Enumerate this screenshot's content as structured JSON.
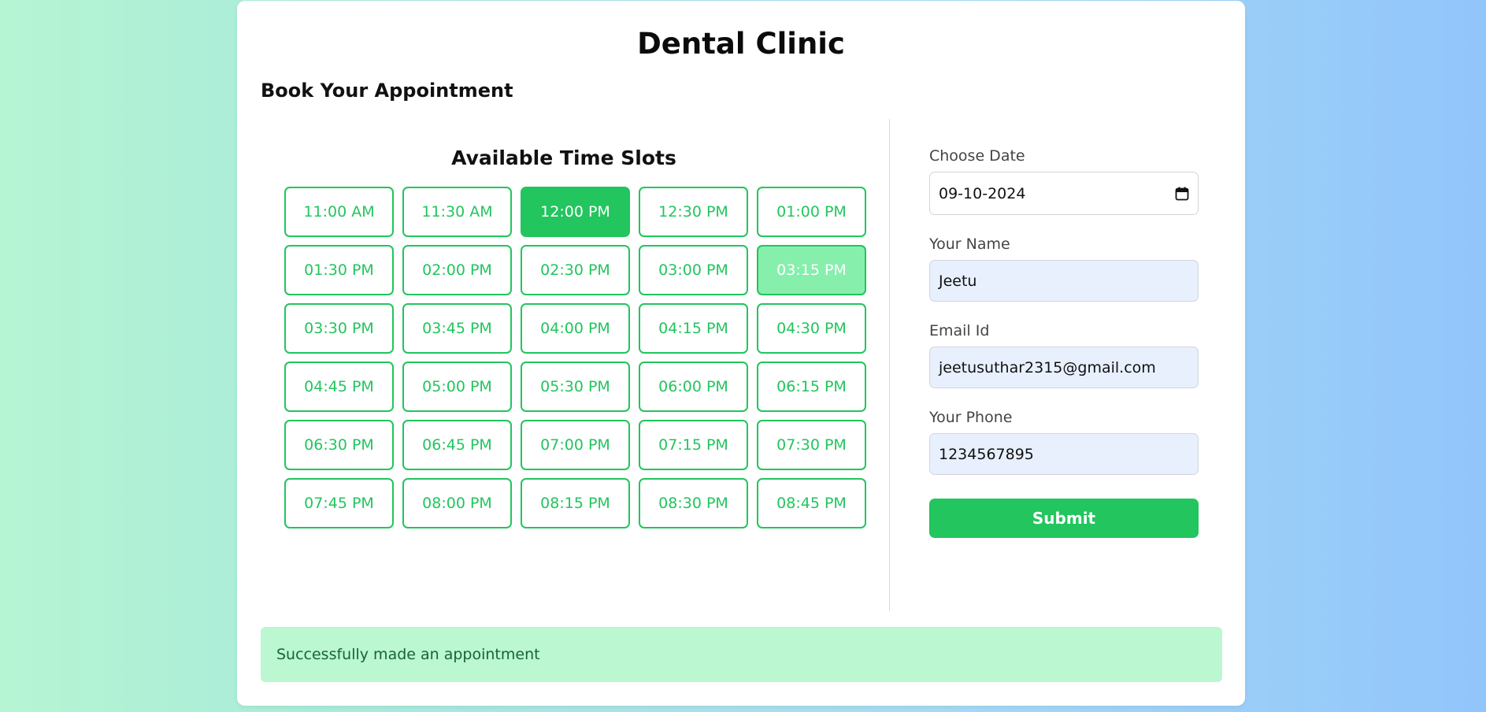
{
  "header": {
    "title": "Dental Clinic",
    "subtitle": "Book Your Appointment"
  },
  "slots": {
    "heading": "Available Time Slots",
    "items": [
      {
        "label": "11:00 AM",
        "state": "available"
      },
      {
        "label": "11:30 AM",
        "state": "available"
      },
      {
        "label": "12:00 PM",
        "state": "selected"
      },
      {
        "label": "12:30 PM",
        "state": "available"
      },
      {
        "label": "01:00 PM",
        "state": "available"
      },
      {
        "label": "01:30 PM",
        "state": "available"
      },
      {
        "label": "02:00 PM",
        "state": "available"
      },
      {
        "label": "02:30 PM",
        "state": "available"
      },
      {
        "label": "03:00 PM",
        "state": "available"
      },
      {
        "label": "03:15 PM",
        "state": "booked"
      },
      {
        "label": "03:30 PM",
        "state": "available"
      },
      {
        "label": "03:45 PM",
        "state": "available"
      },
      {
        "label": "04:00 PM",
        "state": "available"
      },
      {
        "label": "04:15 PM",
        "state": "available"
      },
      {
        "label": "04:30 PM",
        "state": "available"
      },
      {
        "label": "04:45 PM",
        "state": "available"
      },
      {
        "label": "05:00 PM",
        "state": "available"
      },
      {
        "label": "05:30 PM",
        "state": "available"
      },
      {
        "label": "06:00 PM",
        "state": "available"
      },
      {
        "label": "06:15 PM",
        "state": "available"
      },
      {
        "label": "06:30 PM",
        "state": "available"
      },
      {
        "label": "06:45 PM",
        "state": "available"
      },
      {
        "label": "07:00 PM",
        "state": "available"
      },
      {
        "label": "07:15 PM",
        "state": "available"
      },
      {
        "label": "07:30 PM",
        "state": "available"
      },
      {
        "label": "07:45 PM",
        "state": "available"
      },
      {
        "label": "08:00 PM",
        "state": "available"
      },
      {
        "label": "08:15 PM",
        "state": "available"
      },
      {
        "label": "08:30 PM",
        "state": "available"
      },
      {
        "label": "08:45 PM",
        "state": "available"
      }
    ]
  },
  "form": {
    "date_label": "Choose Date",
    "date_value": "09-10-2024",
    "date_icon": "calendar-icon",
    "name_label": "Your Name",
    "name_value": "Jeetu",
    "email_label": "Email Id",
    "email_value": "jeetusuthar2315@gmail.com",
    "phone_label": "Your Phone",
    "phone_value": "1234567895",
    "submit_label": "Submit"
  },
  "status": {
    "message": "Successfully made an appointment"
  },
  "colors": {
    "accent": "#22c55e",
    "booked": "#86efac",
    "alert_bg": "#bbf7d0",
    "alert_text": "#166534",
    "autofill_bg": "#e8f0fe"
  }
}
